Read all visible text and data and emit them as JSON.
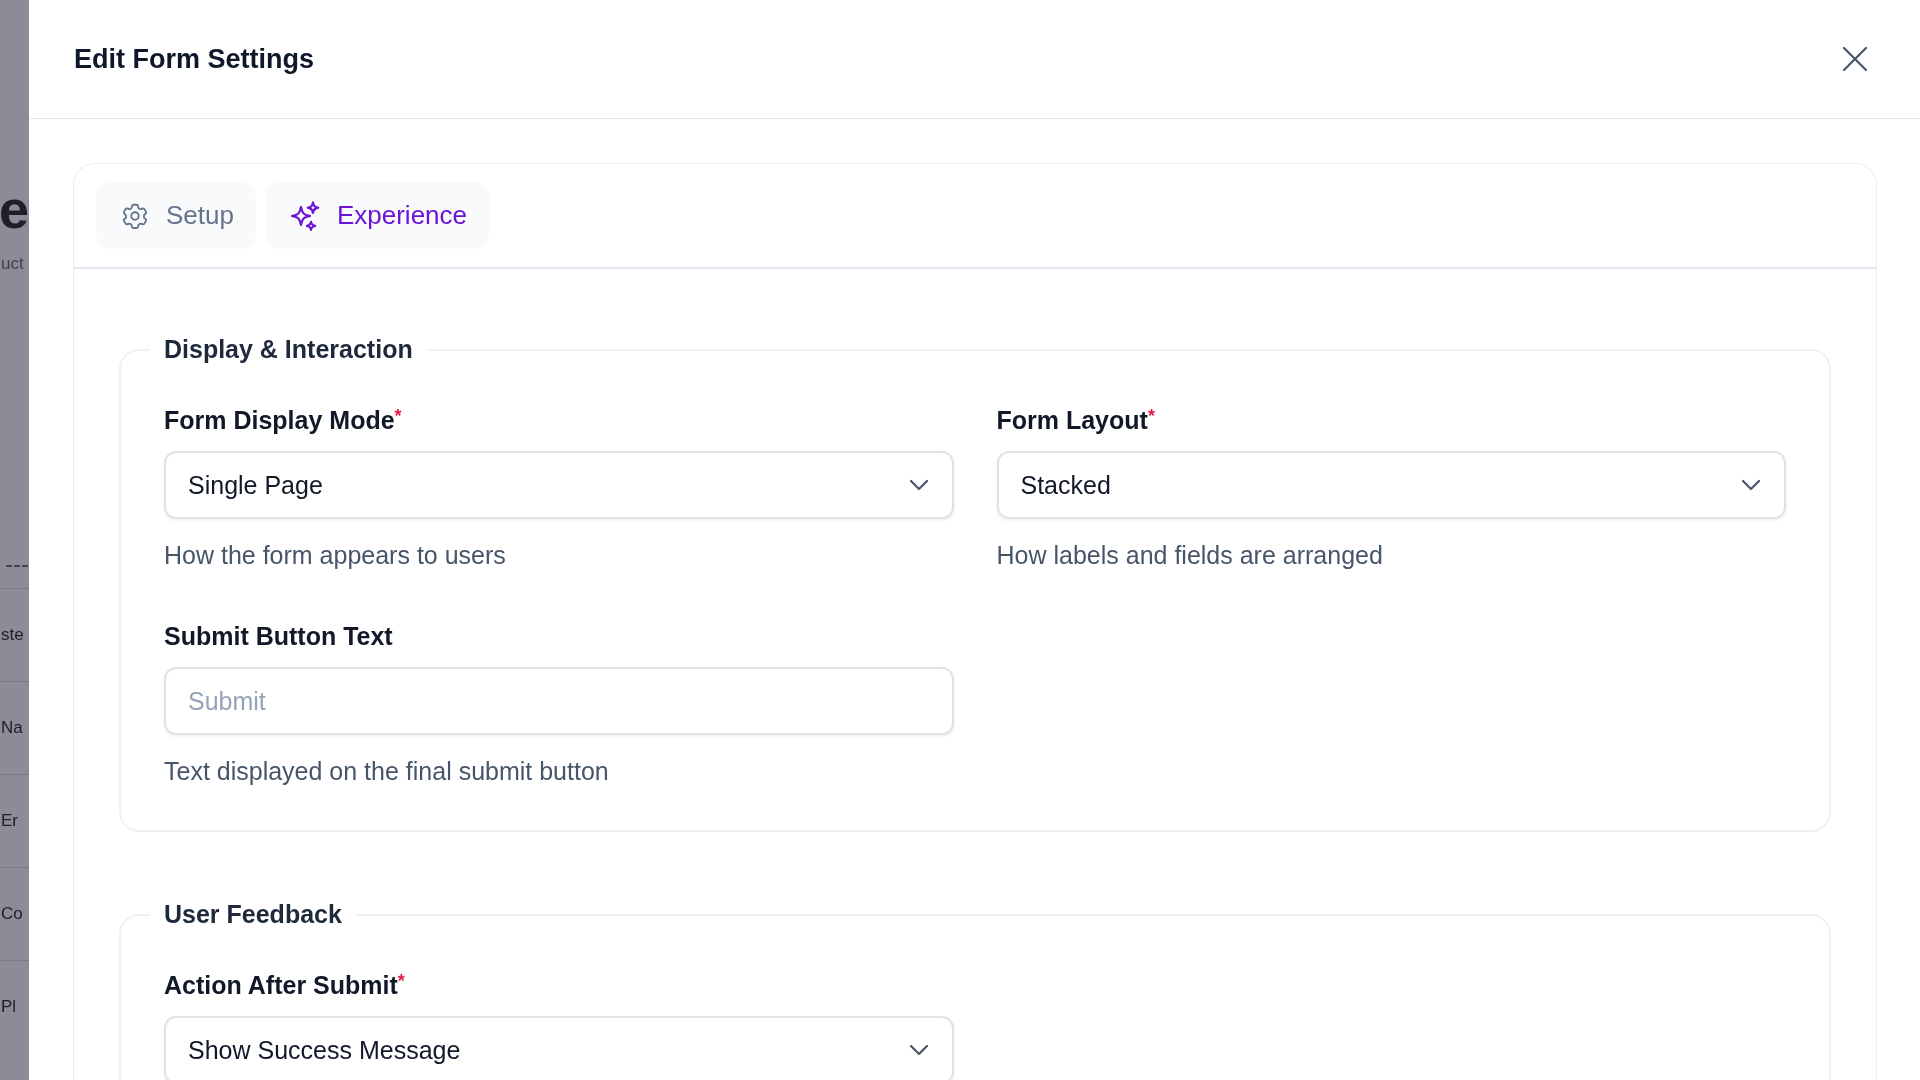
{
  "background_page": {
    "fragments": [
      {
        "kind": "heading",
        "text": "e"
      },
      {
        "kind": "subtitle",
        "text": "uct"
      },
      {
        "kind": "divider",
        "text": "---"
      },
      {
        "kind": "row",
        "text": "ste"
      },
      {
        "kind": "row",
        "text": "Na"
      },
      {
        "kind": "row",
        "text": "Er"
      },
      {
        "kind": "row",
        "text": "Co"
      },
      {
        "kind": "row",
        "text": "Pl"
      }
    ]
  },
  "dialog": {
    "title": "Edit Form Settings"
  },
  "tabs": [
    {
      "label": "Setup",
      "kind": "gear",
      "selected": false
    },
    {
      "label": "Experience",
      "kind": "sparkles",
      "selected": true
    }
  ],
  "sections": [
    {
      "legend": "Display & Interaction",
      "fields": [
        {
          "kind": "select",
          "label": "Form Display Mode",
          "required_mark": "*",
          "value": "Single Page",
          "help": "How the form appears to users"
        },
        {
          "kind": "select",
          "label": "Form Layout",
          "required_mark": "*",
          "value": "Stacked",
          "help": "How labels and fields are arranged"
        },
        {
          "kind": "input",
          "label": "Submit Button Text",
          "placeholder": "Submit",
          "help": "Text displayed on the final submit button"
        }
      ]
    },
    {
      "legend": "User Feedback",
      "fields": [
        {
          "kind": "select",
          "label": "Action After Submit",
          "required_mark": "*",
          "value": "Show Success Message"
        }
      ]
    }
  ]
}
